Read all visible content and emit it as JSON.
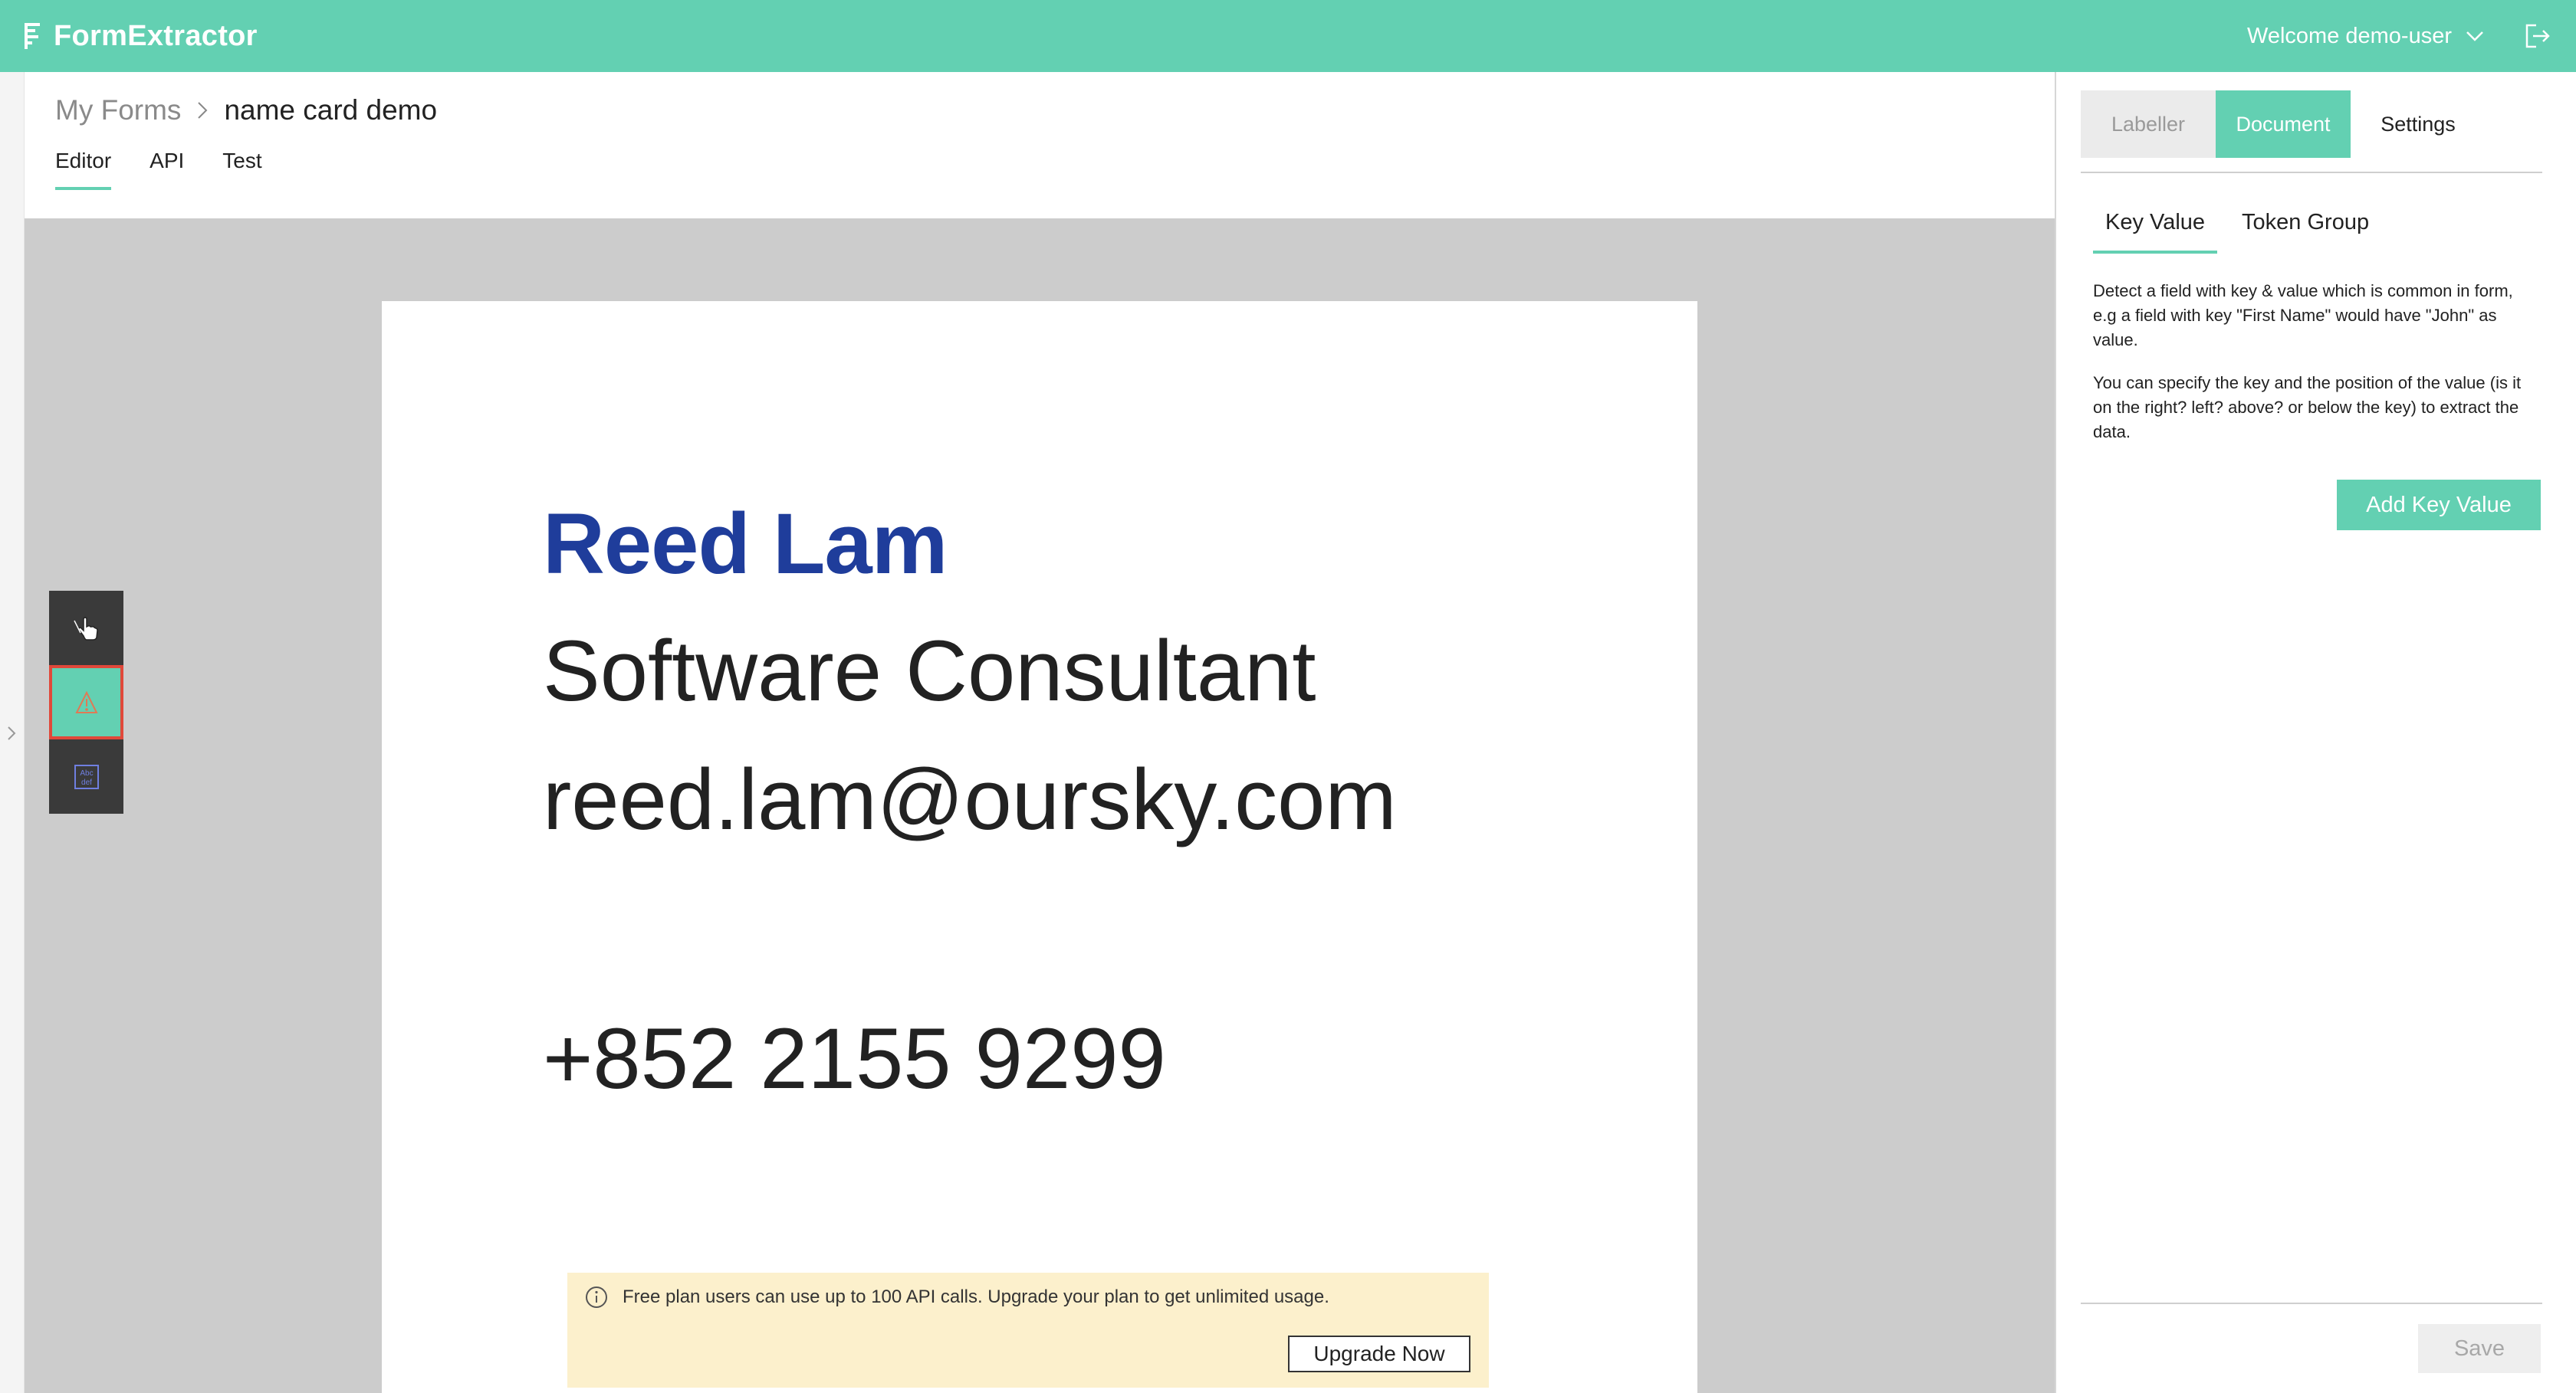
{
  "app": {
    "name": "FormExtractor",
    "logo_icon": "formextractor-logo-icon",
    "accent_color": "#63d0b2"
  },
  "header": {
    "welcome_text": "Welcome demo-user",
    "dropdown_icon": "chevron-down-icon",
    "logout_icon": "logout-icon"
  },
  "breadcrumb": {
    "root": "My Forms",
    "current": "name card demo"
  },
  "main_tabs": [
    {
      "label": "Editor",
      "active": true
    },
    {
      "label": "API",
      "active": false
    },
    {
      "label": "Test",
      "active": false
    }
  ],
  "tools": [
    {
      "name": "select-hand-tool",
      "icon": "hand-pointer-icon",
      "active": false
    },
    {
      "name": "anchor-tool",
      "icon": "anchor-icon",
      "active": true
    },
    {
      "name": "text-region-tool",
      "icon": "text-box-icon",
      "active": false
    }
  ],
  "document": {
    "name": "Reed Lam",
    "title": "Software Consultant",
    "email": "reed.lam@oursky.com",
    "phone": "+852 2155 9299"
  },
  "banner": {
    "icon": "info-icon",
    "text": "Free plan users can use up to 100 API calls. Upgrade your plan to get unlimited usage.",
    "button_label": "Upgrade Now"
  },
  "right_panel": {
    "tabs": [
      {
        "label": "Labeller",
        "state": "disabled"
      },
      {
        "label": "Document",
        "state": "selected"
      },
      {
        "label": "Settings",
        "state": "normal"
      }
    ],
    "sub_tabs": [
      {
        "label": "Key Value",
        "active": true
      },
      {
        "label": "Token Group",
        "active": false
      }
    ],
    "description": [
      "Detect a field with key & value which is common in form, e.g a field with key \"First Name\" would have \"John\" as value.",
      "You can specify the key and the position of the value (is it on the right? left? above? or below the key) to extract the data."
    ],
    "add_button": "Add Key Value",
    "save_button": "Save"
  }
}
